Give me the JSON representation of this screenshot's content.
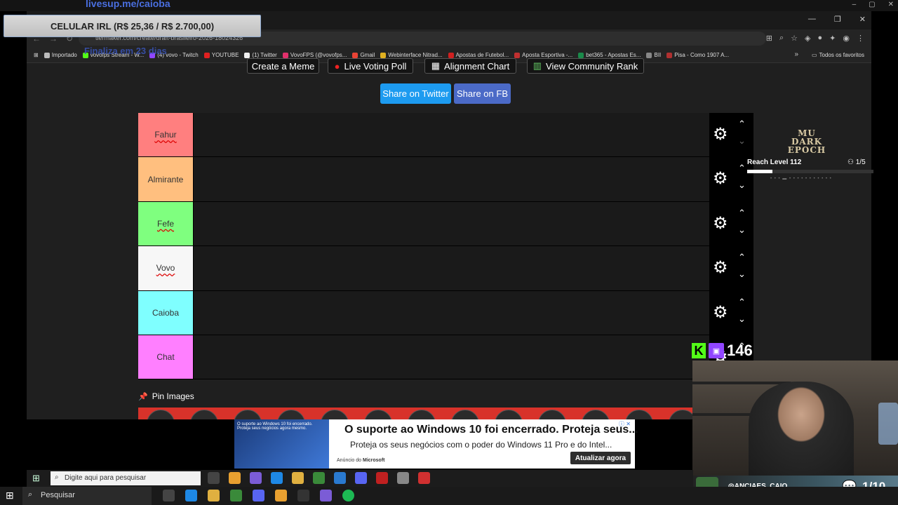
{
  "overlay": {
    "url": "livesup.me/caioba",
    "donation": "CELULAR IRL (R$ 25,36 / R$ 2.700,00)",
    "subtext": "Finaliza em 23 dias"
  },
  "browser": {
    "address": "tiermaker.com/create/draft-brasileiro-2026-18024326",
    "bookmarks": [
      "Importado",
      "vovofps Stream - W...",
      "(4) vovo - Twitch",
      "YOUTUBE",
      "(1) Twitter",
      "VovoFPS (@vovofps...",
      "Gmail",
      "Webinterface Nitrad...",
      "Apostas de Futebol...",
      "Aposta Esportiva -...",
      "bet365 - Apostas Es...",
      "BII",
      "Pisa - Como 1907 A..."
    ],
    "bookmarks_all": "Todos os favoritos"
  },
  "page": {
    "top_buttons": [
      "Create a Meme",
      "Live Voting Poll",
      "Alignment Chart",
      "View Community Rank"
    ],
    "share_twitter": "Share on Twitter",
    "share_fb": "Share on FB",
    "tiers": [
      {
        "label": "Fahur",
        "color": "#ff7f7f"
      },
      {
        "label": "Almirante",
        "color": "#ffbf7f"
      },
      {
        "label": "Fefe",
        "color": "#7fff7f"
      },
      {
        "label": "Vovo",
        "color": "#f7f7f7"
      },
      {
        "label": "Caioba",
        "color": "#7fffff"
      },
      {
        "label": "Chat",
        "color": "#ff7fff"
      }
    ],
    "pin_images": "Pin Images"
  },
  "game": {
    "logo_line1": "MU",
    "logo_line2": "DARK EPOCH",
    "quest": "Reach Level 112",
    "quest_count": "1/5",
    "quest_progress": 0.2
  },
  "stream": {
    "viewer_count": "146",
    "streamer": "ANCIAES_CAIO",
    "chat_counter": "1/10"
  },
  "ad": {
    "thumb_text": "O suporte ao Windows 10 foi encerrado. Proteja seus negócios agora mesmo.",
    "title": "O suporte ao Windows 10 foi encerrado. Proteja seus...",
    "body": "Proteja os seus negócios com o poder do Windows 11 Pro e do Intel...",
    "sponsor_prefix": "Anúncio do ",
    "sponsor": "Microsoft",
    "cta": "Atualizar agora"
  },
  "taskbar": {
    "inner_search": "Digite aqui para pesquisar",
    "search": "Pesquisar"
  },
  "colors": {
    "twitter": "#1d9bf0",
    "facebook": "#4b6ac7",
    "kick": "#53fc18",
    "twitch": "#9146ff"
  }
}
